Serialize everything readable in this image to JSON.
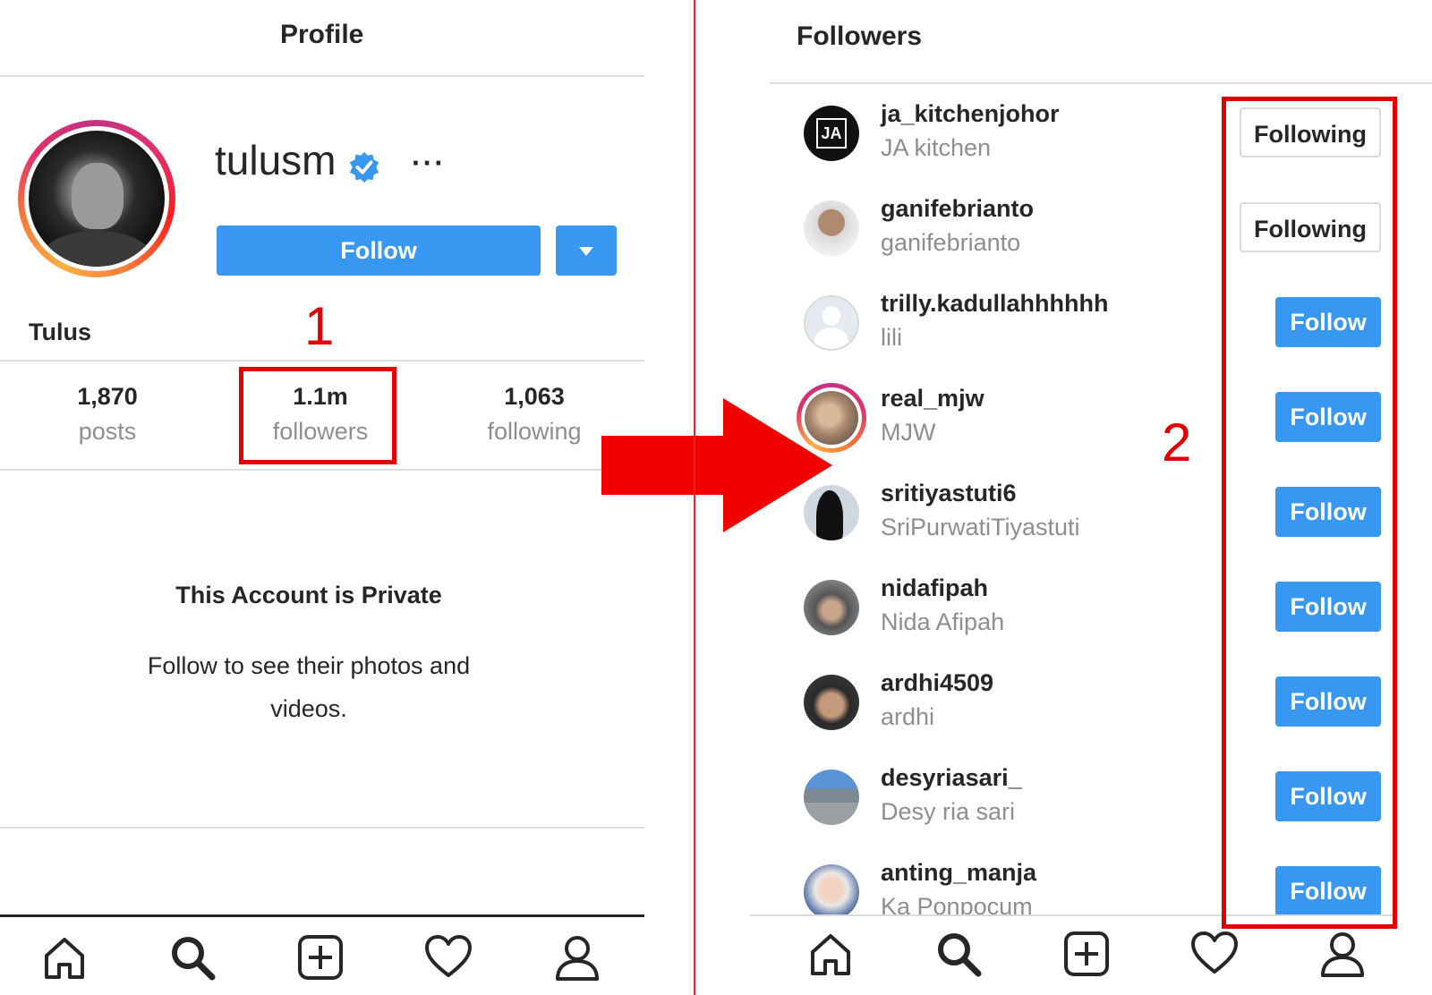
{
  "left": {
    "header_title": "Profile",
    "username": "tulusm",
    "more_label": "···",
    "follow_label": "Follow",
    "full_name": "Tulus",
    "stats": [
      {
        "num": "1,870",
        "label": "posts"
      },
      {
        "num": "1.1m",
        "label": "followers"
      },
      {
        "num": "1,063",
        "label": "following"
      }
    ],
    "private_title": "This Account is Private",
    "private_text": "Follow to see their photos and videos."
  },
  "annotations": {
    "one": "1",
    "two": "2"
  },
  "right": {
    "header_title": "Followers",
    "followers": [
      {
        "user": "ja_kitchenjohor",
        "name": "JA kitchen",
        "button": "Following",
        "avatar": "ja-logo-avatar"
      },
      {
        "user": "ganifebrianto",
        "name": "ganifebrianto",
        "button": "Following",
        "avatar": "man-photo-avatar"
      },
      {
        "user": "trilly.kadullahhhhhh",
        "name": "lili",
        "button": "Follow",
        "avatar": "default-avatar"
      },
      {
        "user": "real_mjw",
        "name": "MJW",
        "button": "Follow",
        "avatar": "story-ring-avatar"
      },
      {
        "user": "sritiyastuti6",
        "name": "SriPurwatiTiyastuti",
        "button": "Follow",
        "avatar": "hijab-silhouette-avatar"
      },
      {
        "user": "nidafipah",
        "name": "Nida Afipah",
        "button": "Follow",
        "avatar": "woman-photo-avatar"
      },
      {
        "user": "ardhi4509",
        "name": "ardhi",
        "button": "Follow",
        "avatar": "face-photo-avatar"
      },
      {
        "user": "desyriasari_",
        "name": "Desy ria sari",
        "button": "Follow",
        "avatar": "landscape-photo-avatar"
      },
      {
        "user": "anting_manja",
        "name": "Ka Ponpocum",
        "button": "Follow",
        "avatar": "girl-photo-avatar"
      }
    ]
  },
  "nav_icons": [
    "home-icon",
    "search-icon",
    "add-post-icon",
    "heart-icon",
    "profile-icon"
  ],
  "colors": {
    "accent_blue": "#3897f0",
    "annotation_red": "#e30000",
    "muted_text": "#8e8e8e",
    "divider": "#dbdbdb"
  }
}
